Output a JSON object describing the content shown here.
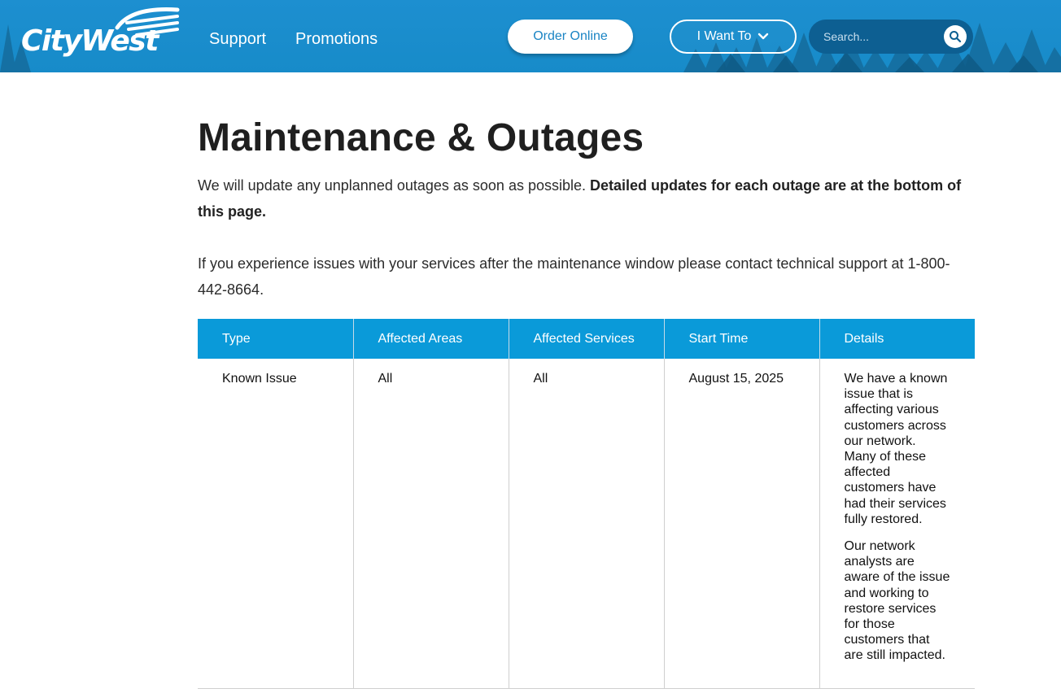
{
  "brand": {
    "logo_text": "CityWest"
  },
  "nav": {
    "links": [
      {
        "label": "Support"
      },
      {
        "label": "Promotions"
      }
    ],
    "order_online_label": "Order Online",
    "i_want_to_label": "I Want To",
    "search": {
      "placeholder": "Search...",
      "icon": "search-icon"
    }
  },
  "main": {
    "title": "Maintenance & Outages",
    "intro_text": "We will update any unplanned outages as soon as possible.",
    "intro_bold": "Detailed updates for each outage are at the bottom of this page.",
    "support_text": "If you experience issues with your services after the maintenance window please contact technical support at 1-800-442-8664."
  },
  "table": {
    "headers": [
      "Type",
      "Affected Areas",
      "Affected Services",
      "Start Time",
      "Details"
    ],
    "rows": [
      {
        "type": "Known Issue",
        "areas": "All",
        "services": "All",
        "start_time": "August 15, 2025",
        "details": [
          "We have a known issue that is affecting various customers across our network. Many of these affected customers have had their services fully restored.",
          "Our network analysts are aware of the issue and working to restore services for those customers that are still impacted."
        ]
      }
    ]
  },
  "colors": {
    "header_blue": "#1d8fd0",
    "table_header_blue": "#0a9ad9",
    "search_bg": "#0d5f92",
    "order_text": "#1a84c4"
  }
}
